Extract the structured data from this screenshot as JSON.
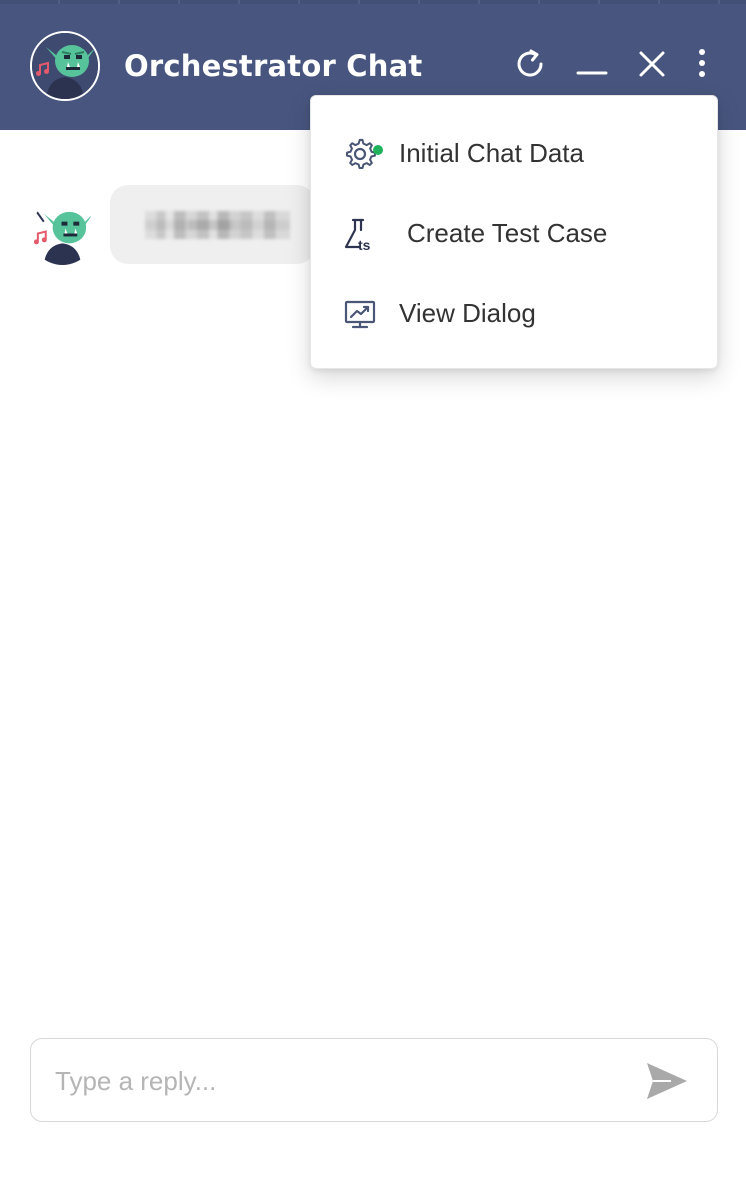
{
  "header": {
    "title": "Orchestrator Chat",
    "background_color": "#48567f",
    "buttons": {
      "refresh_icon": "refresh-icon",
      "minimize_icon": "minimize-icon",
      "close_icon": "close-icon",
      "more_icon": "more-vertical-icon"
    }
  },
  "messages": [
    {
      "sender": "bot",
      "avatar_icon": "orc-avatar",
      "text_blurred": true
    }
  ],
  "dropdown_menu": {
    "items": [
      {
        "label": "Initial Chat Data",
        "icon": "gear-icon",
        "status_dot_color": "#1fb25a"
      },
      {
        "label": "Create Test Case",
        "icon": "flask-ts-icon"
      },
      {
        "label": "View Dialog",
        "icon": "monitor-chart-icon"
      }
    ]
  },
  "composer": {
    "placeholder": "Type a reply...",
    "value": "",
    "send_icon": "send-icon"
  }
}
